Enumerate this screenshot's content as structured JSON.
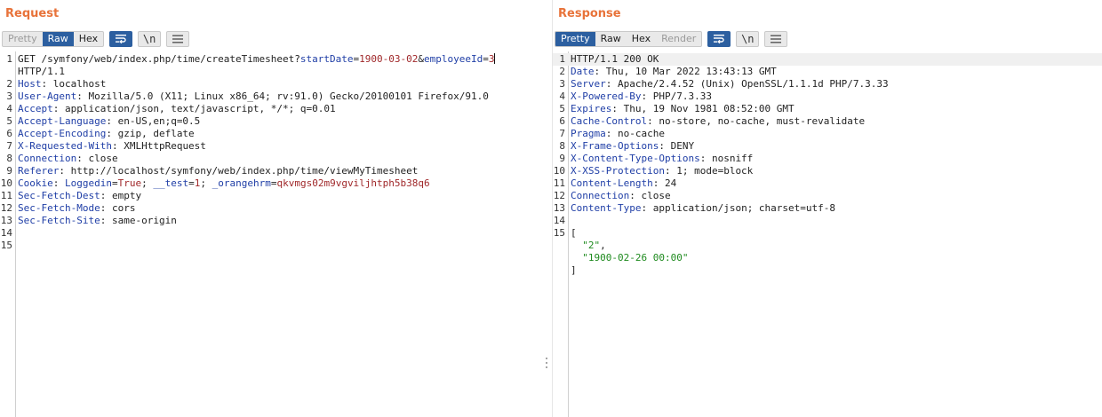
{
  "request": {
    "title": "Request",
    "tabs": [
      "Pretty",
      "Raw",
      "Hex"
    ],
    "active_tab": "Raw",
    "newline_label": "\\n",
    "lines": [
      {
        "n": "1",
        "parts": [
          [
            "",
            "GET /symfony/web/index.php/time/createTimesheet?"
          ],
          [
            "k",
            "startDate"
          ],
          [
            "",
            "="
          ],
          [
            "v",
            "1900-03-02"
          ],
          [
            "",
            "&"
          ],
          [
            "k",
            "employeeId"
          ],
          [
            "",
            "="
          ],
          [
            "v",
            "3"
          ]
        ]
      },
      {
        "n": "",
        "parts": [
          [
            "",
            "HTTP/1.1"
          ]
        ]
      },
      {
        "n": "2",
        "parts": [
          [
            "k",
            "Host"
          ],
          [
            "",
            ": localhost"
          ]
        ]
      },
      {
        "n": "3",
        "parts": [
          [
            "k",
            "User-Agent"
          ],
          [
            "",
            ": Mozilla/5.0 (X11; Linux x86_64; rv:91.0) Gecko/20100101 Firefox/91.0"
          ]
        ]
      },
      {
        "n": "4",
        "parts": [
          [
            "k",
            "Accept"
          ],
          [
            "",
            ": application/json, text/javascript, */*; q=0.01"
          ]
        ]
      },
      {
        "n": "5",
        "parts": [
          [
            "k",
            "Accept-Language"
          ],
          [
            "",
            ": en-US,en;q=0.5"
          ]
        ]
      },
      {
        "n": "6",
        "parts": [
          [
            "k",
            "Accept-Encoding"
          ],
          [
            "",
            ": gzip, deflate"
          ]
        ]
      },
      {
        "n": "7",
        "parts": [
          [
            "k",
            "X-Requested-With"
          ],
          [
            "",
            ": XMLHttpRequest"
          ]
        ]
      },
      {
        "n": "8",
        "parts": [
          [
            "k",
            "Connection"
          ],
          [
            "",
            ": close"
          ]
        ]
      },
      {
        "n": "9",
        "parts": [
          [
            "k",
            "Referer"
          ],
          [
            "",
            ": http://localhost/symfony/web/index.php/time/viewMyTimesheet"
          ]
        ]
      },
      {
        "n": "10",
        "parts": [
          [
            "k",
            "Cookie"
          ],
          [
            "",
            ": "
          ],
          [
            "k",
            "Loggedin"
          ],
          [
            "",
            "="
          ],
          [
            "v",
            "True"
          ],
          [
            "",
            "; "
          ],
          [
            "k",
            "__test"
          ],
          [
            "",
            "="
          ],
          [
            "v",
            "1"
          ],
          [
            "",
            "; "
          ],
          [
            "k",
            "_orangehrm"
          ],
          [
            "",
            "="
          ],
          [
            "v",
            "qkvmgs02m9vgviljhtph5b38q6"
          ]
        ]
      },
      {
        "n": "11",
        "parts": [
          [
            "k",
            "Sec-Fetch-Dest"
          ],
          [
            "",
            ": empty"
          ]
        ]
      },
      {
        "n": "12",
        "parts": [
          [
            "k",
            "Sec-Fetch-Mode"
          ],
          [
            "",
            ": cors"
          ]
        ]
      },
      {
        "n": "13",
        "parts": [
          [
            "k",
            "Sec-Fetch-Site"
          ],
          [
            "",
            ": same-origin"
          ]
        ]
      },
      {
        "n": "14",
        "parts": []
      },
      {
        "n": "15",
        "parts": []
      }
    ]
  },
  "response": {
    "title": "Response",
    "tabs": [
      "Pretty",
      "Raw",
      "Hex",
      "Render"
    ],
    "active_tab": "Pretty",
    "newline_label": "\\n",
    "lines": [
      {
        "n": "1",
        "parts": [
          [
            "",
            "HTTP/1.1 200 OK"
          ]
        ]
      },
      {
        "n": "2",
        "parts": [
          [
            "k",
            "Date"
          ],
          [
            "",
            ": Thu, 10 Mar 2022 13:43:13 GMT"
          ]
        ]
      },
      {
        "n": "3",
        "parts": [
          [
            "k",
            "Server"
          ],
          [
            "",
            ": Apache/2.4.52 (Unix) OpenSSL/1.1.1d PHP/7.3.33"
          ]
        ]
      },
      {
        "n": "4",
        "parts": [
          [
            "k",
            "X-Powered-By"
          ],
          [
            "",
            ": PHP/7.3.33"
          ]
        ]
      },
      {
        "n": "5",
        "parts": [
          [
            "k",
            "Expires"
          ],
          [
            "",
            ": Thu, 19 Nov 1981 08:52:00 GMT"
          ]
        ]
      },
      {
        "n": "6",
        "parts": [
          [
            "k",
            "Cache-Control"
          ],
          [
            "",
            ": no-store, no-cache, must-revalidate"
          ]
        ]
      },
      {
        "n": "7",
        "parts": [
          [
            "k",
            "Pragma"
          ],
          [
            "",
            ": no-cache"
          ]
        ]
      },
      {
        "n": "8",
        "parts": [
          [
            "k",
            "X-Frame-Options"
          ],
          [
            "",
            ": DENY"
          ]
        ]
      },
      {
        "n": "9",
        "parts": [
          [
            "k",
            "X-Content-Type-Options"
          ],
          [
            "",
            ": nosniff"
          ]
        ]
      },
      {
        "n": "10",
        "parts": [
          [
            "k",
            "X-XSS-Protection"
          ],
          [
            "",
            ": 1; mode=block"
          ]
        ]
      },
      {
        "n": "11",
        "parts": [
          [
            "k",
            "Content-Length"
          ],
          [
            "",
            ": 24"
          ]
        ]
      },
      {
        "n": "12",
        "parts": [
          [
            "k",
            "Connection"
          ],
          [
            "",
            ": close"
          ]
        ]
      },
      {
        "n": "13",
        "parts": [
          [
            "k",
            "Content-Type"
          ],
          [
            "",
            ": application/json; charset=utf-8"
          ]
        ]
      },
      {
        "n": "14",
        "parts": []
      },
      {
        "n": "15",
        "parts": [
          [
            "",
            "["
          ]
        ]
      },
      {
        "n": "",
        "parts": [
          [
            "",
            "  "
          ],
          [
            "g",
            "\"2\""
          ],
          [
            "",
            ","
          ]
        ]
      },
      {
        "n": "",
        "parts": [
          [
            "",
            "  "
          ],
          [
            "g",
            "\"1900-02-26 00:00\""
          ]
        ]
      },
      {
        "n": "",
        "parts": [
          [
            "",
            "]"
          ]
        ]
      }
    ]
  },
  "colors": {
    "accent": "#e8733a",
    "active": "#2c5fa0",
    "key": "#1f3ea6",
    "value": "#a0282a",
    "string": "#1e8a1e"
  },
  "icons": [
    "wrap-icon",
    "newline-icon",
    "menu-icon",
    "layout-split-icon",
    "layout-rows-icon",
    "layout-single-icon"
  ]
}
